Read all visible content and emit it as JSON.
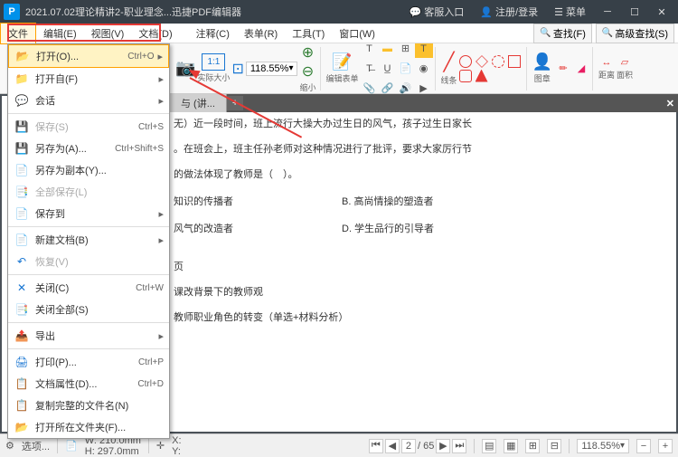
{
  "titlebar": {
    "app_logo": "P",
    "title": "2021.07.02理论精讲2-职业理念...迅捷PDF编辑器",
    "customer_service": "客服入口",
    "login": "注册/登录",
    "menu": "菜单"
  },
  "menubar": {
    "items": [
      "文件",
      "编辑(E)",
      "视图(V)",
      "文档(D)",
      "注释(C)",
      "表单(R)",
      "工具(T)",
      "窗口(W)"
    ],
    "search": "查找(F)",
    "adv_search": "高级查找(S)"
  },
  "file_menu": {
    "items": [
      {
        "icon": "📂",
        "label": "打开(O)...",
        "shortcut": "Ctrl+O",
        "arrow": true,
        "hl": true
      },
      {
        "icon": "📁",
        "label": "打开自(F)",
        "arrow": true
      },
      {
        "icon": "💬",
        "label": "会话",
        "arrow": true
      },
      {
        "sep": true
      },
      {
        "icon": "💾",
        "label": "保存(S)",
        "shortcut": "Ctrl+S",
        "disabled": true
      },
      {
        "icon": "💾",
        "label": "另存为(A)...",
        "shortcut": "Ctrl+Shift+S"
      },
      {
        "icon": "📄",
        "label": "另存为副本(Y)..."
      },
      {
        "icon": "📑",
        "label": "全部保存(L)",
        "disabled": true
      },
      {
        "icon": "📄",
        "label": "保存到",
        "arrow": true
      },
      {
        "sep": true
      },
      {
        "icon": "📄",
        "label": "新建文档(B)",
        "arrow": true
      },
      {
        "icon": "↶",
        "label": "恢复(V)",
        "disabled": true
      },
      {
        "sep": true
      },
      {
        "icon": "✕",
        "label": "关闭(C)",
        "shortcut": "Ctrl+W"
      },
      {
        "icon": "📑",
        "label": "关闭全部(S)"
      },
      {
        "sep": true
      },
      {
        "icon": "📤",
        "label": "导出",
        "arrow": true
      },
      {
        "sep": true
      },
      {
        "icon": "🖨",
        "label": "打印(P)...",
        "shortcut": "Ctrl+P"
      },
      {
        "icon": "📋",
        "label": "文档属性(D)...",
        "shortcut": "Ctrl+D"
      },
      {
        "icon": "📋",
        "label": "复制完整的文件名(N)"
      },
      {
        "icon": "📂",
        "label": "打开所在文件夹(F)..."
      }
    ]
  },
  "toolbar": {
    "zoom": "118.55%",
    "actual_size": "实际大小",
    "zoom_out": "缩小",
    "edit_form": "编辑表单",
    "line": "线条",
    "image": "图章",
    "distance": "距离",
    "area": "面积"
  },
  "tab": {
    "label": "与 (讲..."
  },
  "document": {
    "line1": "无）近一段时间，班上流行大操大办过生日的风气，孩子过生日家长",
    "line2": "。在班会上，班主任孙老师对这种情况进行了批评，要求大家厉行节",
    "line3": "的做法体现了教师是（　）。",
    "optA": "知识的传播者",
    "optB": "B. 高尚情操的塑造者",
    "optC": "风气的改造者",
    "optD": "D. 学生品行的引导者",
    "line4": "页",
    "line5": "课改背景下的教师观",
    "line6": "教师职业角色的转变（单选+材料分析）"
  },
  "statusbar": {
    "options": "选项...",
    "width": "W: 210.0mm",
    "height": "H: 297.0mm",
    "x": "X:",
    "y": "Y:",
    "page_current": "2",
    "page_total": "/ 65",
    "zoom": "118.55%"
  }
}
